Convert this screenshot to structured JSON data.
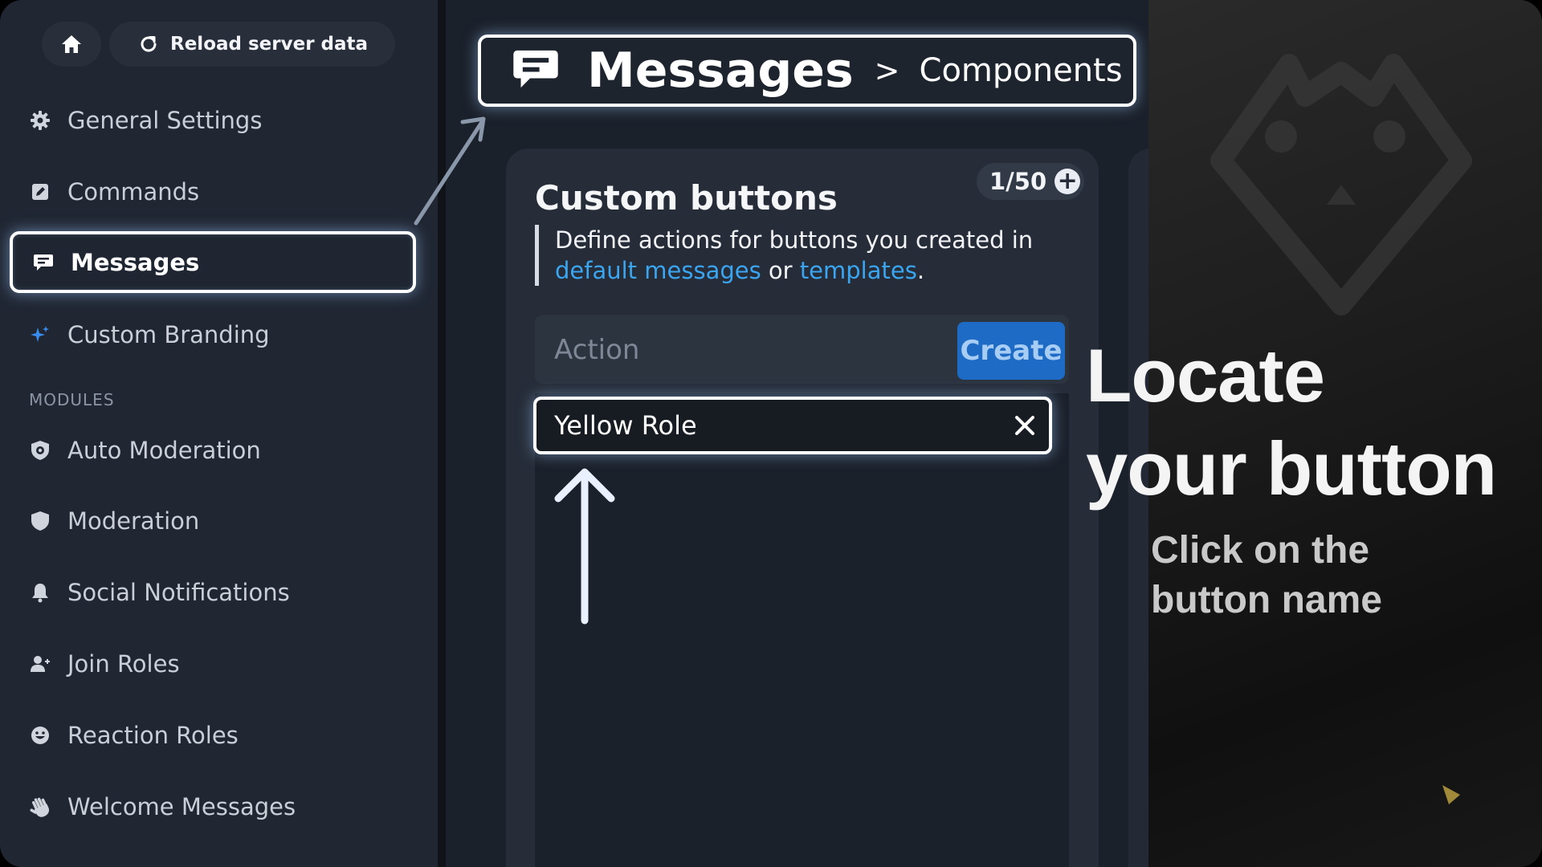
{
  "top_bar": {
    "home_icon": "home-icon",
    "reload_label": "Reload server data",
    "reload_icon": "refresh-icon"
  },
  "sidebar": {
    "items": [
      {
        "label": "General Settings",
        "icon": "gear-icon"
      },
      {
        "label": "Commands",
        "icon": "pencil-square-icon"
      },
      {
        "label": "Messages",
        "icon": "message-icon",
        "active": true
      },
      {
        "label": "Custom Branding",
        "icon": "sparkle-icon"
      }
    ],
    "section_label": "MODULES",
    "modules": [
      {
        "label": "Auto Moderation",
        "icon": "shield-gear-icon"
      },
      {
        "label": "Moderation",
        "icon": "shield-icon"
      },
      {
        "label": "Social Notifications",
        "icon": "bell-icon"
      },
      {
        "label": "Join Roles",
        "icon": "user-plus-icon"
      },
      {
        "label": "Reaction Roles",
        "icon": "smiley-icon"
      },
      {
        "label": "Welcome Messages",
        "icon": "wave-hand-icon"
      }
    ]
  },
  "breadcrumb": {
    "title": "Messages",
    "separator": ">",
    "sub": "Components",
    "icon": "message-icon"
  },
  "card": {
    "title": "Custom buttons",
    "counter": "1/50",
    "description_prefix": "Define actions for buttons you created in",
    "link1": "default messages",
    "connector": "or",
    "link2": "templates",
    "period": ".",
    "action_placeholder": "Action",
    "create_label": "Create",
    "list_item": "Yellow Role"
  },
  "overlay": {
    "headline_line1": "Locate",
    "headline_line2": "your button",
    "subline_line1": "Click on the",
    "subline_line2": "button name"
  },
  "colors": {
    "accent": "#1d6bc4",
    "link": "#3aa5f0",
    "sidebar_bg": "#202733",
    "card_bg": "#262d39"
  }
}
